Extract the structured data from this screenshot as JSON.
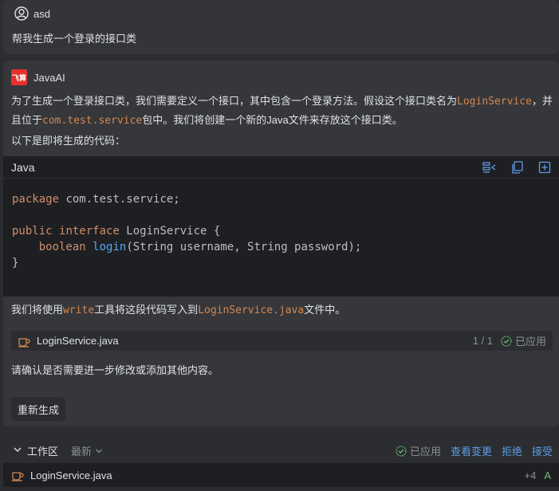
{
  "user": {
    "name": "asd",
    "message": "帮我生成一个登录的接口类"
  },
  "ai": {
    "name": "JavaAI",
    "logo_text": "飞算",
    "p1_a": "为了生成一个登录接口类，我们需要定义一个接口，其中包含一个登录方法。假设这个接口类名为",
    "p1_code1": "LoginService",
    "p1_b": "，并",
    "p1_c": "且位于",
    "p1_code2": "com.test.service",
    "p1_d": "包中。我们将创建一个新的Java文件来存放这个接口类。",
    "p2": "以下是即将生成的代码：",
    "code": {
      "lang": "Java",
      "kw_package": "package",
      "pkg": " com.test.service;",
      "kw_public": "public",
      "kw_interface": "interface",
      "iface": " LoginService {",
      "kw_boolean": "boolean",
      "method": "login",
      "params": "(String username, String password);",
      "close": "}"
    },
    "p3_a": "我们将使用",
    "p3_code1": "write",
    "p3_b": "工具将这段代码写入到",
    "p3_code2": "LoginService.java",
    "p3_c": "文件中。",
    "file": {
      "name": "LoginService.java",
      "pager": "1 / 1",
      "status": "已应用"
    },
    "p4": "请确认是否需要进一步修改或添加其他内容。",
    "regen_label": "重新生成"
  },
  "workspace": {
    "title": "工作区",
    "sort": "最新",
    "status": "已应用",
    "view_changes": "查看变更",
    "reject": "拒绝",
    "accept": "接受",
    "file_name": "LoginService.java",
    "additions": "+4",
    "vcs_status": "A"
  },
  "colors": {
    "accent_link": "#5c9de8",
    "code_highlight": "#d4874f",
    "added_green": "#6fbf73",
    "logo_red": "#e5322d"
  }
}
